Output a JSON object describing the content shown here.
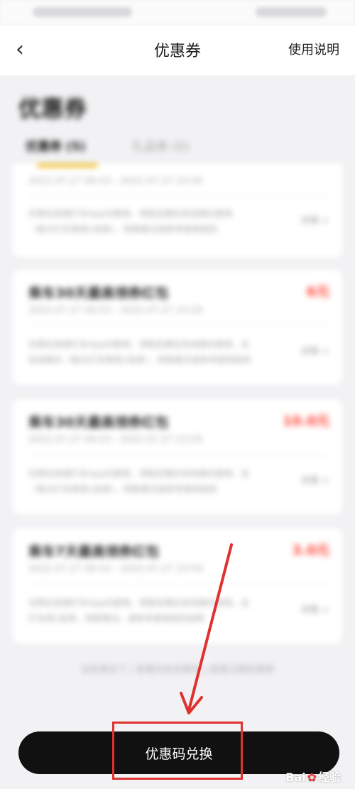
{
  "nav": {
    "title": "优惠券",
    "usage_link": "使用说明",
    "back_icon": "chevron-left-icon"
  },
  "page": {
    "heading": "优惠券",
    "tabs": [
      {
        "label": "优惠券 (5)"
      },
      {
        "label": "礼品券 (0)"
      }
    ]
  },
  "coupons": [
    {
      "date": "2022.07.27 09:53 - 2022.07.27 23:59",
      "amount": "",
      "desc1": "仅限在高德打车App内使用，领取后需在有效期内使用",
      "desc2": "（每次打车限用1张券），特殊情况请参考使用规则",
      "detail": "详情 >"
    },
    {
      "title": "乘车30天最高领券红包",
      "date": "2022.07.27 09:53 - 2022.07.27 23:59",
      "amount": "6元",
      "desc1": "仅限在高德打车App内使用，领取后需在有效期内使用，在",
      "desc2": "有效期内（每次打车限用1张券），特殊情况请参考使用规则",
      "detail": "详情 >"
    },
    {
      "title": "乘车30天最高领券红包",
      "date": "2022.07.27 09:53 - 2022.07.27 23:59",
      "amount": "10.0元",
      "desc1": "仅限在高德打车App内使用，领取后需在有效期内使用，在",
      "desc2": "（每次打车限用1张券），特殊情况请参考使用规则",
      "detail": "详情 >"
    },
    {
      "title": "乘车7天最高领券红包",
      "date": "2022.07.27 09:53 - 2022.07.27 23:59",
      "amount": "3.0元",
      "desc1": "仅限在高德打车App内使用，领取后需在有效期内使用，在",
      "desc2": "打车限1张券，特殊情况，请参考使用规则说明",
      "detail": "详情 >"
    }
  ],
  "footer_note": "没有更多了 | 查看历史优惠券 | 查看过期优惠券",
  "redeem_button": {
    "label": "优惠码兑换"
  },
  "annotation": {
    "color": "#e03131"
  },
  "watermark": {
    "brand_left": "Bai",
    "brand_right": "经验"
  }
}
